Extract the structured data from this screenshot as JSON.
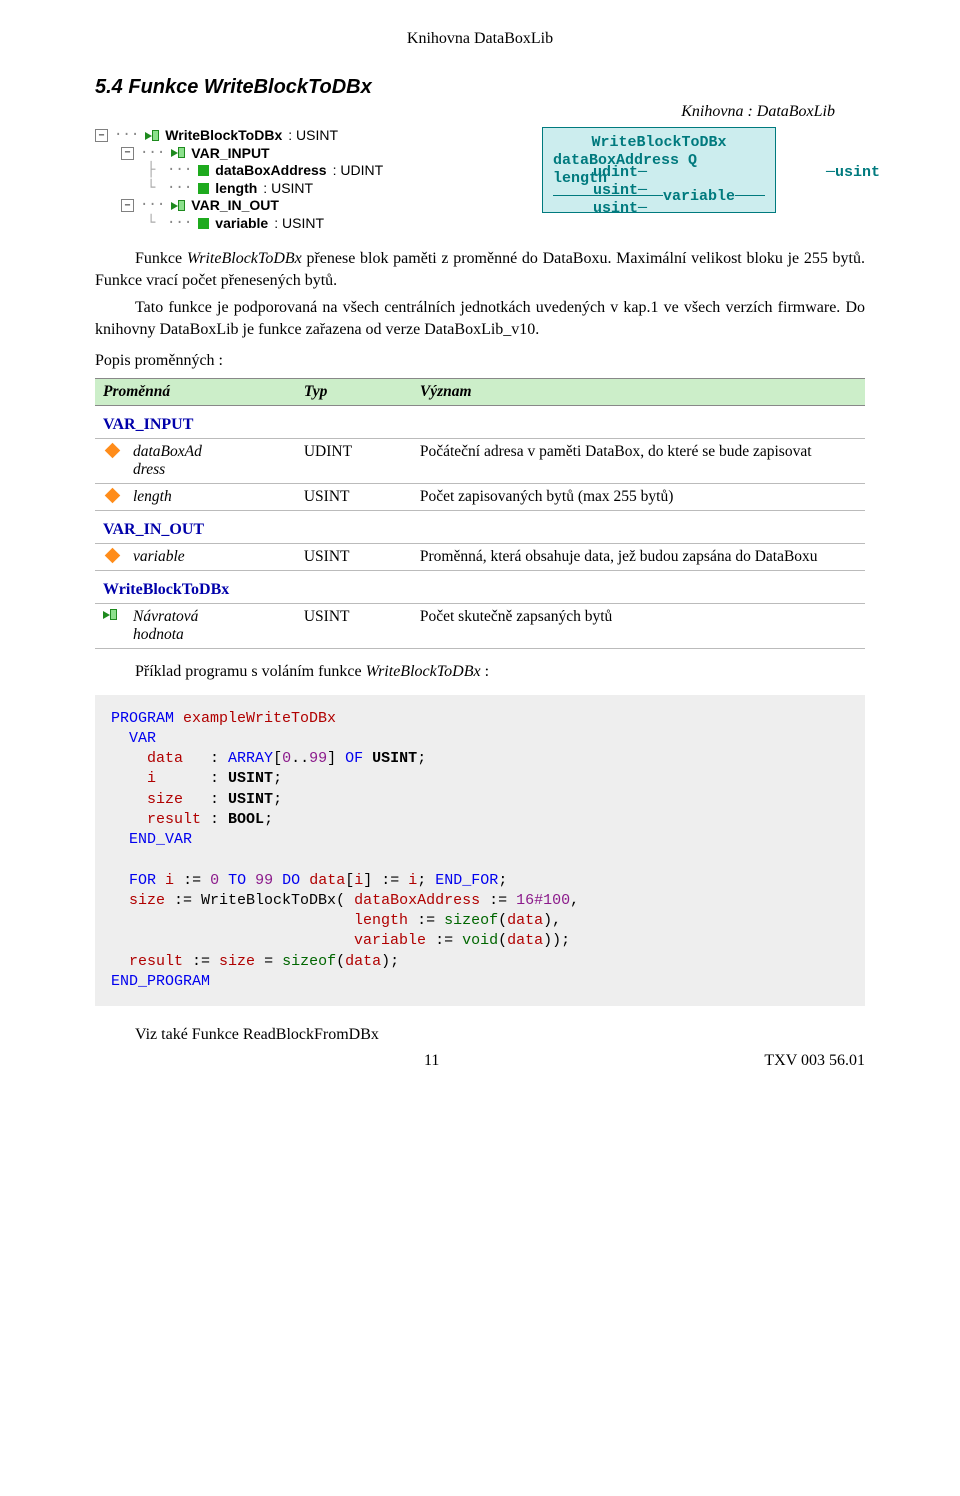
{
  "header": "Knihovna DataBoxLib",
  "section_title": "5.4  Funkce WriteBlockToDBx",
  "lib_line": "Knihovna : DataBoxLib",
  "tree": {
    "n0": "WriteBlockToDBx",
    "t0": "USINT",
    "n1": "VAR_INPUT",
    "n2": "dataBoxAddress",
    "t2": "UDINT",
    "n3": "length",
    "t3": "USINT",
    "n4": "VAR_IN_OUT",
    "n5": "variable",
    "t5": "USINT"
  },
  "block": {
    "title": "WriteBlockToDBx",
    "row1l": "udint",
    "row1c": "dataBoxAddress Q",
    "row1r": "usint",
    "row2l": "usint",
    "row2c": "length",
    "row3l": "usint",
    "row3c": "variable"
  },
  "para1": "Funkce WriteBlockToDBx přenese blok paměti z proměnné do DataBoxu. Maximální velikost bloku je 255 bytů. Funkce vrací počet přenesených bytů.",
  "para2": "Tato funkce je podporovaná na všech centrálních jednotkách uvedených v kap.1 ve všech verzích firmware. Do knihovny DataBoxLib je funkce zařazena od verze DataBoxLib_v10.",
  "popis": "Popis proměnných :",
  "table": {
    "h1": "Proměnná",
    "h2": "Typ",
    "h3": "Význam",
    "s1": "VAR_INPUT",
    "r1c1a": "dataBoxAd",
    "r1c1b": "dress",
    "r1c2": "UDINT",
    "r1c3": "Počáteční adresa v paměti DataBox, do které se bude zapisovat",
    "r2c1": "length",
    "r2c2": "USINT",
    "r2c3": "Počet zapisovaných bytů (max 255 bytů)",
    "s2": "VAR_IN_OUT",
    "r3c1": "variable",
    "r3c2": "USINT",
    "r3c3": "Proměnná, která obsahuje data, jež budou zapsána do DataBoxu",
    "s3": "WriteBlockToDBx",
    "r4c1a": "Návratová",
    "r4c1b": "hodnota",
    "r4c2": "USINT",
    "r4c3": "Počet skutečně zapsaných bytů"
  },
  "example_label": "Příklad programu s voláním funkce WriteBlockToDBx :",
  "see_also": "Viz také  Funkce ReadBlockFromDBx",
  "footer_left": "11",
  "footer_right": "TXV 003 56.01",
  "code": {
    "prog_name": "exampleWriteToDBx",
    "arr_range": "ARRAY[0..99]",
    "usint": "USINT",
    "bool": "BOOL",
    "for_lim": "99",
    "hex_addr": "16#100",
    "len": "sizeof(data)",
    "var": "void(data)",
    "final": "sizeof(data)"
  }
}
